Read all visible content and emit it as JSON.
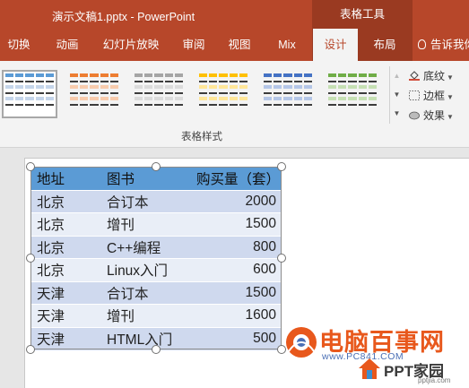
{
  "app": {
    "document_title": "演示文稿1.pptx - PowerPoint",
    "context_tab_group": "表格工具"
  },
  "tabs": [
    {
      "label": "切换"
    },
    {
      "label": "动画"
    },
    {
      "label": "幻灯片放映"
    },
    {
      "label": "审阅"
    },
    {
      "label": "视图"
    },
    {
      "label": "Mix"
    },
    {
      "label": "设计",
      "active": true
    },
    {
      "label": "布局"
    }
  ],
  "tell_me": "告诉我你",
  "ribbon": {
    "group_label": "表格样式",
    "table_styles": [
      {
        "name": "style-blue",
        "header": "#5b9bd5",
        "band": "#c5d5ea"
      },
      {
        "name": "style-orange",
        "header": "#ed7d31",
        "band": "#f8cbad"
      },
      {
        "name": "style-gray",
        "header": "#a5a5a5",
        "band": "#dbdbdb"
      },
      {
        "name": "style-gold",
        "header": "#ffc000",
        "band": "#ffe699"
      },
      {
        "name": "style-darkblue",
        "header": "#4472c4",
        "band": "#b4c6e7"
      },
      {
        "name": "style-green",
        "header": "#70ad47",
        "band": "#c6e0b4"
      }
    ],
    "commands": {
      "shading": "底纹",
      "borders": "边框",
      "effects": "效果"
    }
  },
  "table": {
    "headers": [
      "地址",
      "图书",
      "购买量（套）"
    ],
    "rows": [
      [
        "北京",
        "合订本",
        "2000"
      ],
      [
        "北京",
        "增刊",
        "1500"
      ],
      [
        "北京",
        "C++编程",
        "800"
      ],
      [
        "北京",
        "Linux入门",
        "600"
      ],
      [
        "天津",
        "合订本",
        "1500"
      ],
      [
        "天津",
        "增刊",
        "1600"
      ],
      [
        "天津",
        "HTML入门",
        "500"
      ]
    ]
  },
  "watermark": {
    "brand": "电脑百事网",
    "url": "www.PC841.COM",
    "brand2": "PPT家园",
    "url2": "pptjia.com"
  },
  "colors": {
    "accent": "#b7472a",
    "context_tab": "#9a3a21",
    "table_header": "#5b9bd5",
    "table_band_odd": "#cfd9ee",
    "table_band_even": "#e9eef7"
  }
}
